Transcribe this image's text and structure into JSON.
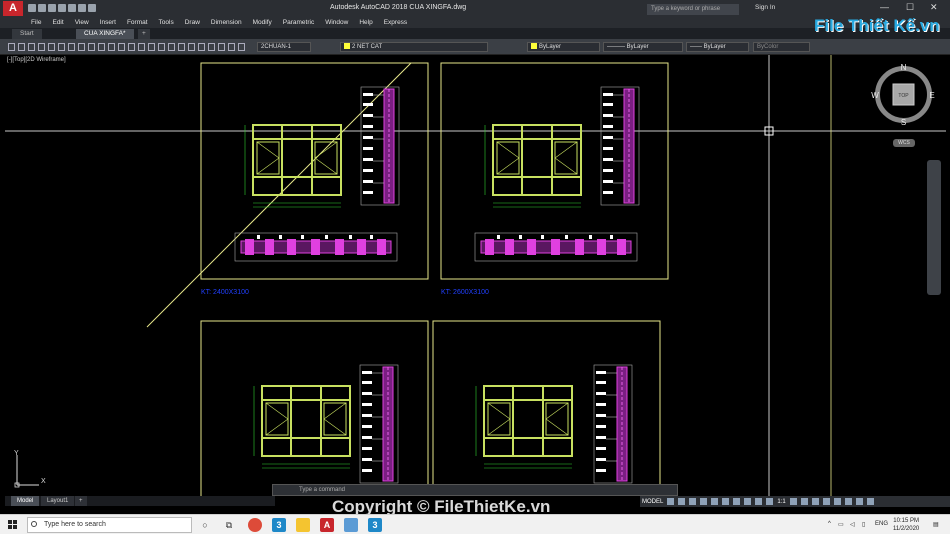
{
  "titlebar": {
    "app_logo": "A",
    "title": "Autodesk AutoCAD 2018    CUA XINGFA.dwg",
    "search_placeholder": "Type a keyword or phrase",
    "sign_in": "Sign In",
    "minimize": "—",
    "maximize": "☐",
    "close": "✕"
  },
  "menu": [
    "File",
    "Edit",
    "View",
    "Insert",
    "Format",
    "Tools",
    "Draw",
    "Dimension",
    "Modify",
    "Parametric",
    "Window",
    "Help",
    "Express"
  ],
  "tabs": [
    {
      "label": "Start"
    },
    {
      "label": "CUA XINGFA*"
    },
    {
      "label": "+"
    }
  ],
  "ribbon": {
    "dimstyle": "2CHUAN-1",
    "layer": "2 NET CAT",
    "color": "ByLayer",
    "linetype": "ByLayer",
    "lineweight": "ByLayer",
    "plotstyle": "ByColor"
  },
  "viewport": {
    "label": "[-][Top][2D Wireframe]",
    "sheet_label_1": "KT: 2400X3100",
    "sheet_label_2": "KT: 2600X3100",
    "ucs_y": "Y",
    "ucs_x": "X"
  },
  "viewcube": {
    "n": "N",
    "s": "S",
    "e": "E",
    "w": "W",
    "top": "TOP",
    "wcs": "WCS"
  },
  "command_line": {
    "placeholder": "Type a command"
  },
  "layout_tabs": [
    "Model",
    "Layout1",
    "+"
  ],
  "status": {
    "model": "MODEL",
    "scale": "1:1"
  },
  "taskbar": {
    "search_placeholder": "Type here to search",
    "language": "ENG",
    "time": "10:15 PM",
    "date": "11/2/2020"
  },
  "brand": {
    "text": "File Thiết Kế.vn"
  },
  "watermark": {
    "text": "Copyright © FileThietKe.vn"
  },
  "colors": {
    "title_bg": "#2b2e33",
    "canvas_bg": "#000000",
    "frame": "#e6e68a",
    "window_frame": "#c8e060",
    "profile": "#e040e0",
    "label_blue": "#2040ff",
    "brand_blue": "#28a9e0"
  }
}
